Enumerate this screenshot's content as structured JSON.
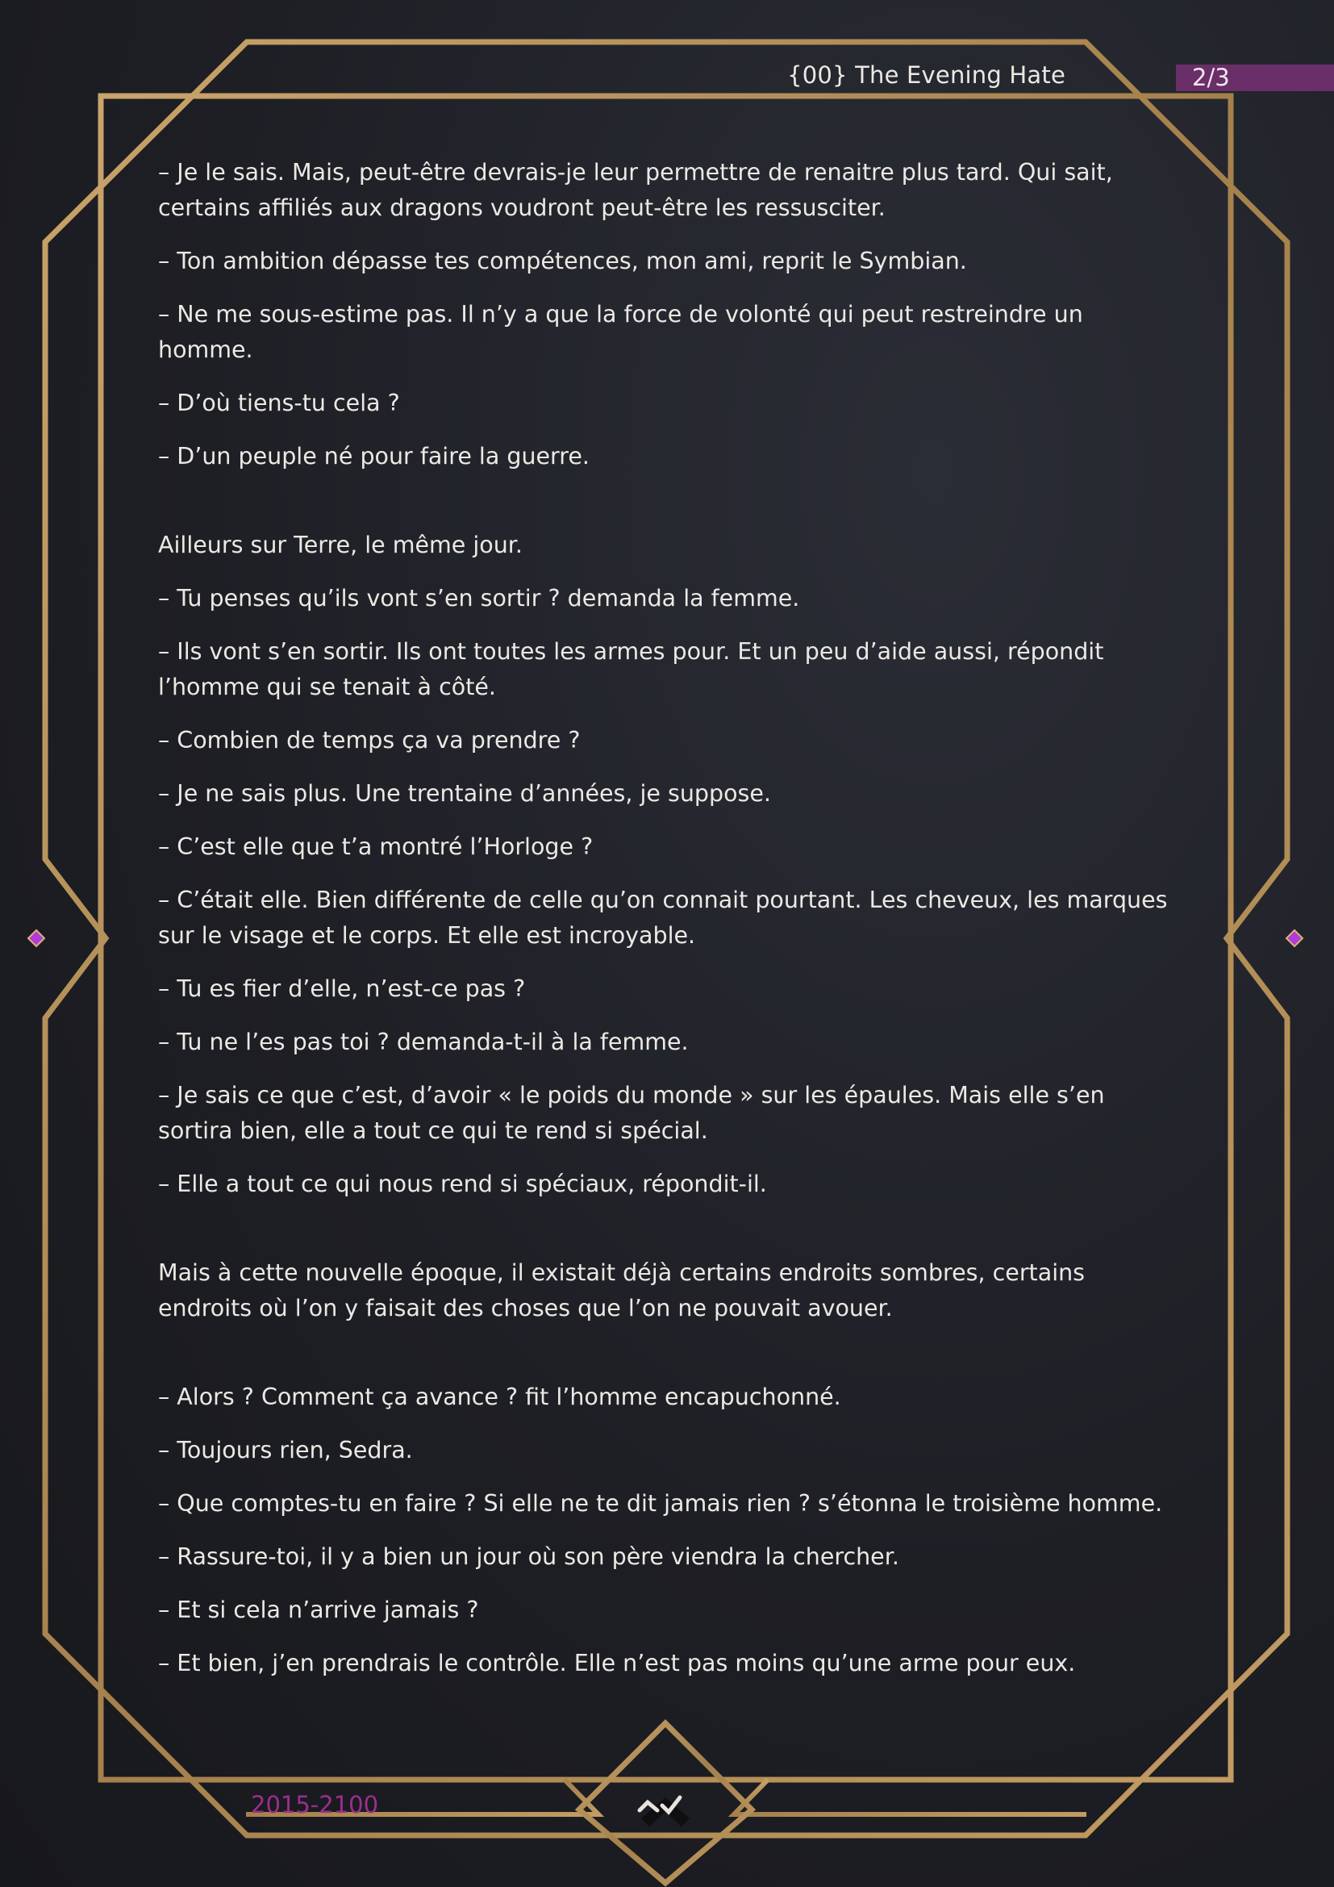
{
  "header": {
    "title": "{00} The Evening Hate",
    "page_indicator": "2/3"
  },
  "paragraphs": [
    {
      "text": "– Je le sais. Mais, peut-être devrais-je leur permettre de renaitre plus tard. Qui sait, certains affiliés aux dragons voudront peut-être les ressusciter.",
      "scene_break": false
    },
    {
      "text": "– Ton ambition dépasse tes compétences, mon ami, reprit le Symbian.",
      "scene_break": false
    },
    {
      "text": "– Ne me sous-estime pas. Il n’y a que la force de volonté qui peut restreindre un homme.",
      "scene_break": false
    },
    {
      "text": "– D’où tiens-tu cela ?",
      "scene_break": false
    },
    {
      "text": "– D’un peuple né pour faire la guerre.",
      "scene_break": false
    },
    {
      "text": "Ailleurs sur Terre, le même jour.",
      "scene_break": true
    },
    {
      "text": "– Tu penses qu’ils vont s’en sortir ? demanda la femme.",
      "scene_break": false
    },
    {
      "text": "– Ils vont s’en sortir. Ils ont toutes les armes pour. Et un peu d’aide aussi, répondit l’homme qui se tenait à côté.",
      "scene_break": false
    },
    {
      "text": "– Combien de temps ça va prendre ?",
      "scene_break": false
    },
    {
      "text": "– Je ne sais plus. Une trentaine d’années, je suppose.",
      "scene_break": false
    },
    {
      "text": "– C’est elle que t’a montré l’Horloge ?",
      "scene_break": false
    },
    {
      "text": "– C’était elle. Bien différente de celle qu’on connait pourtant. Les cheveux, les marques sur le visage et le corps. Et elle est incroyable.",
      "scene_break": false
    },
    {
      "text": "– Tu es fier d’elle, n’est-ce pas ?",
      "scene_break": false
    },
    {
      "text": "– Tu ne l’es pas toi ? demanda-t-il à la femme.",
      "scene_break": false
    },
    {
      "text": "– Je sais ce que c’est, d’avoir « le poids du monde » sur les épaules. Mais elle s’en sortira bien, elle a tout ce qui te rend si spécial.",
      "scene_break": false
    },
    {
      "text": "– Elle a tout ce qui nous rend si spéciaux, répondit-il.",
      "scene_break": false
    },
    {
      "text": "Mais à cette nouvelle époque, il existait déjà certains endroits sombres, certains endroits où l’on y faisait des choses que l’on ne pouvait avouer.",
      "scene_break": true
    },
    {
      "text": "– Alors ? Comment ça avance ? fit l’homme encapuchonné.",
      "scene_break": true
    },
    {
      "text": "– Toujours rien, Sedra.",
      "scene_break": false
    },
    {
      "text": "– Que comptes-tu en faire ? Si elle ne te dit jamais rien ? s’étonna le troisième homme.",
      "scene_break": false
    },
    {
      "text": "– Rassure-toi, il y a bien un jour où son père viendra la chercher.",
      "scene_break": false
    },
    {
      "text": "– Et si cela n’arrive jamais ?",
      "scene_break": false
    },
    {
      "text": "– Et bien, j’en prendrais le contrôle. Elle n’est pas moins qu’une arme pour eux.",
      "scene_break": false
    }
  ],
  "footer": {
    "years": "2015-2100",
    "scroll_icon": "chevron-up-icon"
  },
  "colors": {
    "gold": "#b58e58",
    "accent_purple": "#6a2e68",
    "years_purple": "#9c2e8e",
    "gem_purple": "#b23ad6",
    "text": "#ece9e4",
    "background": "#1e1f25"
  }
}
